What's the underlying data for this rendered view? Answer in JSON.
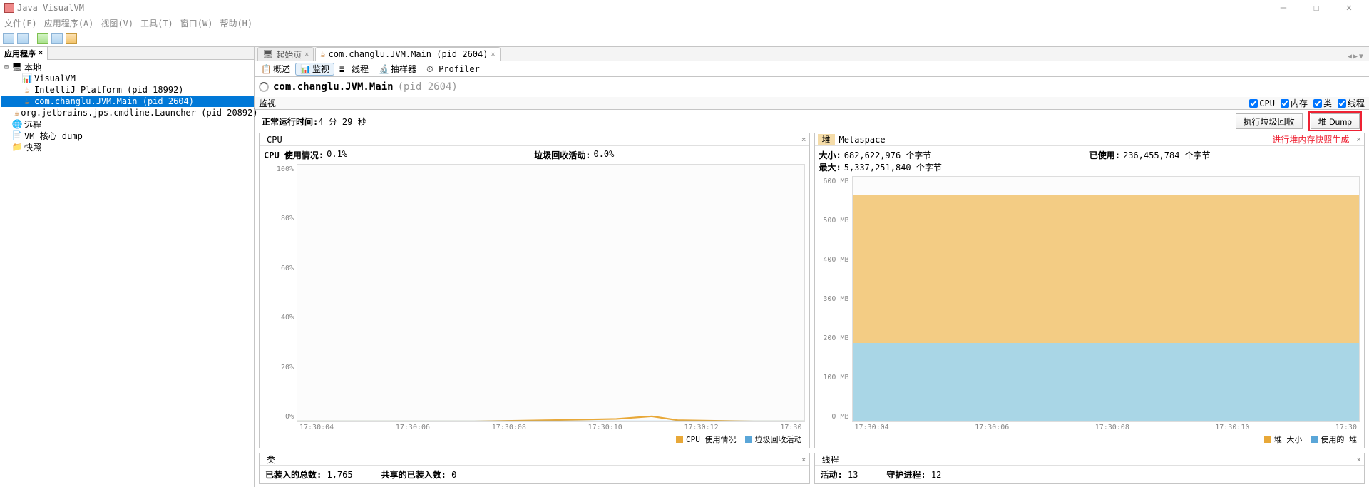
{
  "window": {
    "title": "Java VisualVM"
  },
  "menu": {
    "file": "文件(F)",
    "app": "应用程序(A)",
    "view": "视图(V)",
    "tools": "工具(T)",
    "window": "窗口(W)",
    "help": "帮助(H)"
  },
  "sidebar": {
    "tab_label": "应用程序",
    "local": "本地",
    "remote": "远程",
    "coredump": "VM 核心 dump",
    "snapshot": "快照",
    "items": {
      "visualvm": "VisualVM",
      "intellij": "IntelliJ Platform (pid 18992)",
      "main": "com.changlu.JVM.Main (pid 2604)",
      "jps": "org.jetbrains.jps.cmdline.Launcher (pid 20892)"
    }
  },
  "content_tabs": {
    "start": "起始页",
    "main": "com.changlu.JVM.Main (pid 2604)"
  },
  "subtabs": {
    "overview": "概述",
    "monitor": "监视",
    "threads": "线程",
    "sampler": "抽样器",
    "profiler": "Profiler"
  },
  "detail": {
    "title": "com.changlu.JVM.Main",
    "pid": "(pid 2604)"
  },
  "monitor": {
    "header_label": "监视",
    "opt_cpu": "CPU",
    "opt_mem": "内存",
    "opt_class": "类",
    "opt_thread": "线程",
    "uptime_label": "正常运行时间:",
    "uptime_value": "4 分 29 秒",
    "btn_gc": "执行垃圾回收",
    "btn_dump": "堆 Dump"
  },
  "cpu_panel": {
    "tab": "CPU",
    "usage_label": "CPU 使用情况:",
    "usage_value": "0.1%",
    "gc_label": "垃圾回收活动:",
    "gc_value": "0.0%",
    "legend_cpu": "CPU 使用情况",
    "legend_gc": "垃圾回收活动"
  },
  "heap_panel": {
    "tab_heap": "堆",
    "tab_meta": "Metaspace",
    "annotation": "进行堆内存快照生成",
    "size_label": "大小:",
    "size_value": "682,622,976 个字节",
    "used_label": "已使用:",
    "used_value": "236,455,784 个字节",
    "max_label": "最大:",
    "max_value": "5,337,251,840 个字节",
    "legend_size": "堆 大小",
    "legend_used": "使用的 堆"
  },
  "class_panel": {
    "tab": "类",
    "loaded_label": "已装入的总数:",
    "loaded_value": "1,765",
    "shared_label": "共享的已装入数:",
    "shared_value": "0"
  },
  "thread_panel": {
    "tab": "线程",
    "active_label": "活动:",
    "active_value": "13",
    "daemon_label": "守护进程:",
    "daemon_value": "12"
  },
  "chart_data": [
    {
      "type": "line",
      "name": "cpu",
      "x": [
        "17:30:04",
        "17:30:06",
        "17:30:08",
        "17:30:10",
        "17:30:12",
        "17:30"
      ],
      "series": [
        {
          "name": "CPU 使用情况",
          "values": [
            0,
            0,
            0,
            0,
            0,
            0
          ]
        },
        {
          "name": "垃圾回收活动",
          "values": [
            0,
            0,
            0,
            0,
            0,
            0
          ]
        }
      ],
      "ylim": [
        0,
        100
      ],
      "yunit": "%",
      "yticks": [
        "100%",
        "80%",
        "60%",
        "40%",
        "20%",
        "0%"
      ]
    },
    {
      "type": "area",
      "name": "heap",
      "x": [
        "17:30:04",
        "17:30:06",
        "17:30:08",
        "17:30:10",
        "17:30"
      ],
      "series": [
        {
          "name": "堆 大小",
          "value_mb": 650
        },
        {
          "name": "使用的 堆",
          "value_mb": 225
        }
      ],
      "ylim": [
        0,
        700
      ],
      "yunit": "MB",
      "yticks": [
        "600 MB",
        "500 MB",
        "400 MB",
        "300 MB",
        "200 MB",
        "100 MB",
        "0 MB"
      ]
    }
  ]
}
